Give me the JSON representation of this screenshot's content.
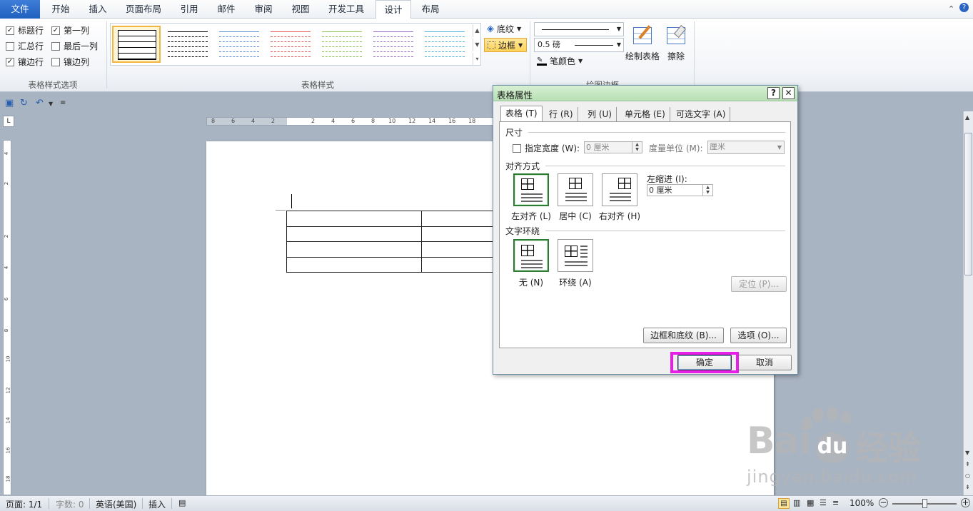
{
  "ribbon_tabs": [
    "文件",
    "开始",
    "插入",
    "页面布局",
    "引用",
    "邮件",
    "审阅",
    "视图",
    "开发工具",
    "设计",
    "布局"
  ],
  "active_tab": "设计",
  "style_options": {
    "items": [
      {
        "label": "标题行",
        "checked": true
      },
      {
        "label": "第一列",
        "checked": true
      },
      {
        "label": "汇总行",
        "checked": false
      },
      {
        "label": "最后一列",
        "checked": false
      },
      {
        "label": "镶边行",
        "checked": true
      },
      {
        "label": "镶边列",
        "checked": false
      }
    ],
    "group_label": "表格样式选项"
  },
  "table_styles": {
    "group_label": "表格样式",
    "thumb_colors": [
      "#000000",
      "#000000",
      "#5b8fd6",
      "#e05a5a",
      "#8cc152",
      "#9a6fc2",
      "#4fb3d9"
    ]
  },
  "shading_label": "底纹",
  "borders_label": "边框",
  "line_weight": "0.5 磅",
  "pen_color_label": "笔颜色",
  "draw_table_label": "绘制表格",
  "erase_label": "擦除",
  "draw_borders_group_label": "绘图边框",
  "dialog": {
    "title": "表格属性",
    "help": "?",
    "close": "✕",
    "tabs": [
      "表格 (T)",
      "行 (R)",
      "列 (U)",
      "单元格 (E)",
      "可选文字 (A)"
    ],
    "size_label": "尺寸",
    "specify_width_label": "指定宽度 (W):",
    "width_value": "0 厘米",
    "measure_unit_label": "度量单位 (M):",
    "measure_unit_value": "厘米",
    "alignment_label": "对齐方式",
    "align_left": "左对齐 (L)",
    "align_center": "居中 (C)",
    "align_right": "右对齐 (H)",
    "left_indent_label": "左缩进 (I):",
    "left_indent_value": "0 厘米",
    "wrap_label": "文字环绕",
    "wrap_none": "无 (N)",
    "wrap_around": "环绕 (A)",
    "position_button": "定位 (P)...",
    "borders_shading_button": "边框和底纹 (B)...",
    "options_button": "选项 (O)...",
    "ok_button": "确定",
    "cancel_button": "取消"
  },
  "ruler_h_labels": [
    "8",
    "6",
    "4",
    "2",
    "2",
    "4",
    "6",
    "8",
    "10",
    "12",
    "14",
    "16",
    "18"
  ],
  "ruler_v_labels": [
    "4",
    "2",
    "2",
    "4",
    "6",
    "8",
    "10",
    "12",
    "14",
    "16",
    "18"
  ],
  "status": {
    "page": "页面: 1/1",
    "words": "字数: 0",
    "language": "英语(美国)",
    "mode": "插入",
    "zoom": "100%"
  },
  "watermark": {
    "brand": "Bai",
    "brand_cn": "经验",
    "url": "jingyan.baidu.com"
  }
}
